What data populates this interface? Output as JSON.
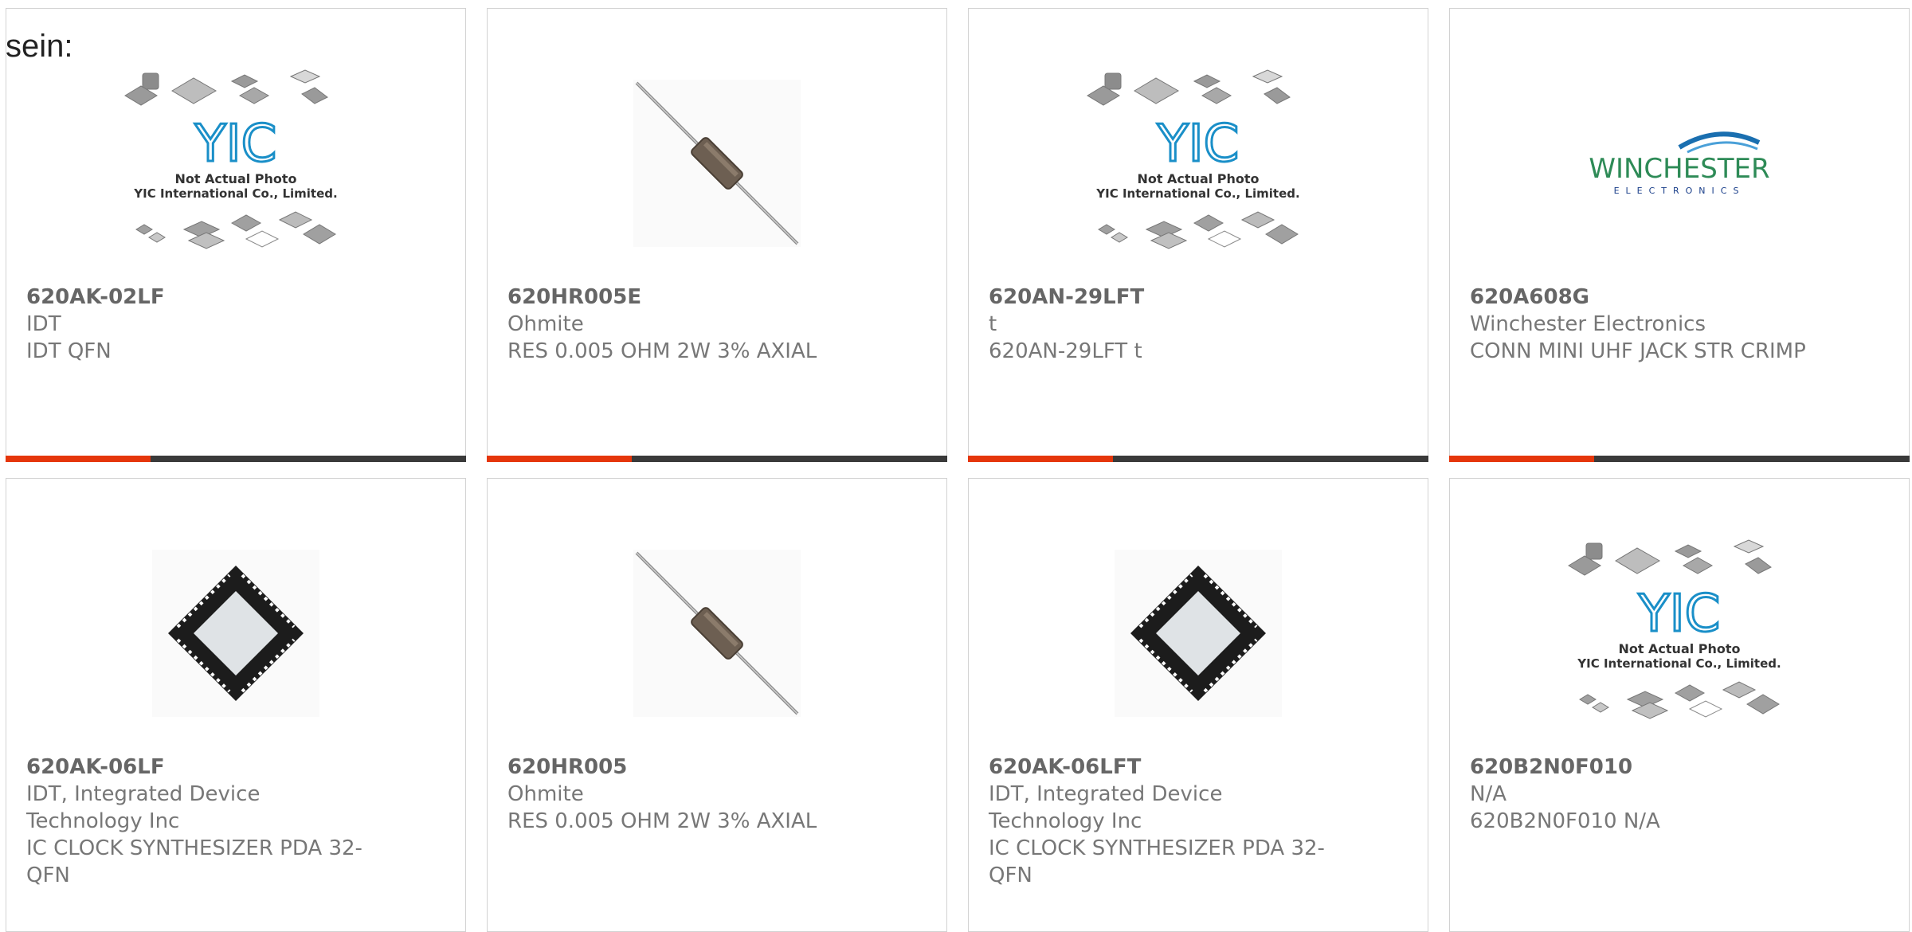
{
  "lead_text": "sein:",
  "brand_colors": {
    "accent": "#e5360b",
    "bar_dark": "#3a3a3a",
    "yic_blue": "#1a8fc8",
    "winchester_green": "#2e8b57"
  },
  "products": [
    {
      "part_number": "620AK-02LF",
      "manufacturer": "IDT",
      "description": "IDT QFN",
      "image": "yic-placeholder"
    },
    {
      "part_number": "620HR005E",
      "manufacturer": "Ohmite",
      "description": "RES 0.005 OHM 2W 3% AXIAL",
      "image": "axial-resistor"
    },
    {
      "part_number": "620AN-29LFT",
      "manufacturer": "t",
      "description": "620AN-29LFT t",
      "image": "yic-placeholder"
    },
    {
      "part_number": "620A608G",
      "manufacturer": "Winchester Electronics",
      "description": "CONN MINI UHF JACK STR CRIMP",
      "image": "winchester-logo"
    },
    {
      "part_number": "620AK-06LF",
      "manufacturer": "IDT, Integrated Device Technology Inc",
      "description": "IC CLOCK SYNTHESIZER PDA 32-QFN",
      "image": "qfn-chip"
    },
    {
      "part_number": "620HR005",
      "manufacturer": "Ohmite",
      "description": "RES 0.005 OHM 2W 3% AXIAL",
      "image": "axial-resistor"
    },
    {
      "part_number": "620AK-06LFT",
      "manufacturer": "IDT, Integrated Device Technology Inc",
      "description": "IC CLOCK SYNTHESIZER PDA 32-QFN",
      "image": "qfn-chip"
    },
    {
      "part_number": "620B2N0F010",
      "manufacturer": "N/A",
      "description": "620B2N0F010 N/A",
      "image": "yic-placeholder"
    }
  ],
  "yic": {
    "logo": "YIC",
    "line1": "Not Actual Photo",
    "line2": "YIC International Co., Limited."
  },
  "winchester": {
    "name": "WINCHESTER",
    "sub": "ELECTRONICS"
  }
}
